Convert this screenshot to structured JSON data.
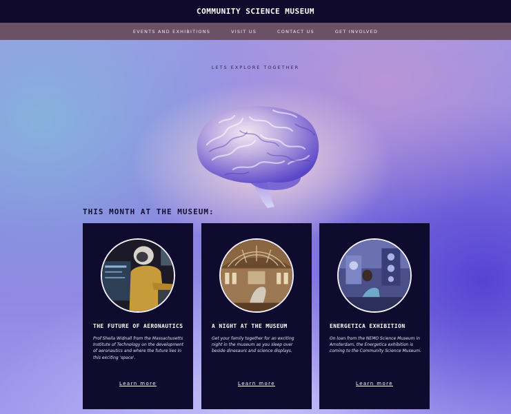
{
  "header": {
    "site_title": "COMMUNITY SCIENCE MUSEUM"
  },
  "nav": {
    "items": [
      {
        "label": "EVENTS AND EXHIBITIONS"
      },
      {
        "label": "VISIT US"
      },
      {
        "label": "CONTACT US"
      },
      {
        "label": "GET INVOLVED"
      }
    ]
  },
  "hero": {
    "tagline": "LETS EXPLORE TOGETHER",
    "image": "brain-illustration"
  },
  "events": {
    "heading": "THIS MONTH AT THE MUSEUM:",
    "cards": [
      {
        "title": "THE FUTURE OF AERONAUTICS",
        "description": "Prof Sheila Widnall from the Massachusetts Institute of Technology on the development of aeronautics and where the future lies in this exciting 'space'.",
        "link_label": "Learn more",
        "image": "astronaut-photo"
      },
      {
        "title": "A NIGHT AT THE MUSEUM",
        "description": "Get your family together for an exciting night in the museum as you sleep over beside dinosaurs and science displays.",
        "link_label": "Learn more",
        "image": "museum-hall-photo"
      },
      {
        "title": "ENERGETICA EXHIBITION",
        "description": "On loan from the NEMO Science Museum in Amsterdam, the Energetica exhibition is coming to the Community Science Museum.",
        "link_label": "Learn more",
        "image": "exhibition-photo"
      }
    ]
  },
  "colors": {
    "header_bg": "#100a2c",
    "nav_bg": "#6b5166",
    "card_bg": "#0f0b2e",
    "accent": "#7d6fdc"
  }
}
